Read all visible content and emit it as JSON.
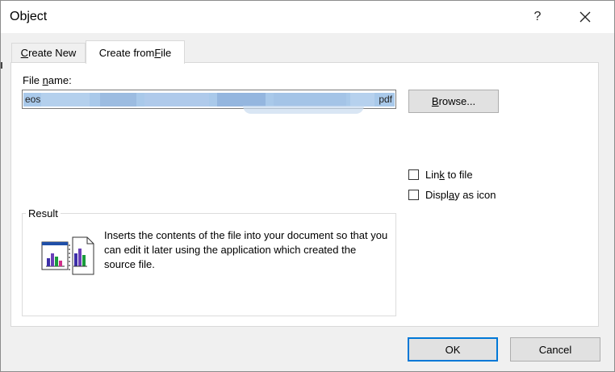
{
  "window": {
    "title": "Object"
  },
  "titlebar": {
    "help_label": "?"
  },
  "tabs": [
    {
      "label": "Create New",
      "pre": "",
      "mnemonic": "C",
      "post": "reate New"
    },
    {
      "label": "Create from File",
      "pre": "Create from ",
      "mnemonic": "F",
      "post": "ile"
    }
  ],
  "file": {
    "label": "File name:",
    "label_pre": "File ",
    "label_mnemonic": "n",
    "label_post": "ame:",
    "value_start": "eos",
    "value_end": "pdf"
  },
  "browse": {
    "label": "Browse...",
    "pre": "",
    "mnemonic": "B",
    "post": "rowse..."
  },
  "options": {
    "link": {
      "label": "Link to file",
      "pre": "Lin",
      "mnemonic": "k",
      "post": " to file",
      "checked": false
    },
    "display": {
      "label": "Display as icon",
      "pre": "Displ",
      "mnemonic": "a",
      "post": "y as icon",
      "checked": false
    }
  },
  "result": {
    "legend": "Result",
    "text": "Inserts the contents of the file into your document so that you can edit it later using the application which created the source file."
  },
  "footer": {
    "ok_label": "OK",
    "cancel_label": "Cancel"
  },
  "colors": {
    "accent": "#0078d7",
    "selection": "#a9c9ea"
  }
}
